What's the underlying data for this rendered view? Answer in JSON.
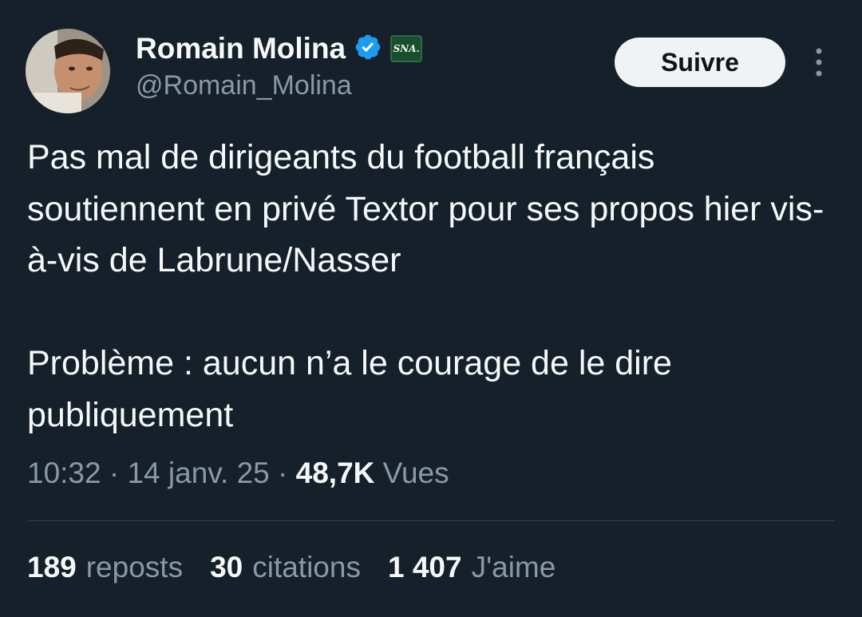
{
  "author": {
    "display_name": "Romain Molina",
    "handle": "@Romain_Molina",
    "verified_icon": "verified-badge-icon",
    "affiliate_badge": "SNA."
  },
  "follow_button": {
    "label": "Suivre"
  },
  "more_menu": {
    "icon": "more-vertical-icon"
  },
  "tweet": {
    "paragraphs": [
      "Pas mal de dirigeants du football français soutiennent en privé Textor pour ses propos hier vis-à-vis de Labrune/Nasser",
      "Problème : aucun n’a le courage de le dire publiquement"
    ]
  },
  "meta": {
    "time": "10:32",
    "separator": "·",
    "date": "14 janv. 25",
    "views_count": "48,7K",
    "views_label": "Vues"
  },
  "stats": {
    "reposts_count": "189",
    "reposts_label": "reposts",
    "quotes_count": "30",
    "quotes_label": "citations",
    "likes_count": "1 407",
    "likes_label": "J'aime"
  },
  "colors": {
    "background": "#15202b",
    "text": "#f7f9f9",
    "secondary": "#8b98a5",
    "verified": "#1d9bf0",
    "button_bg": "#eff3f4"
  }
}
